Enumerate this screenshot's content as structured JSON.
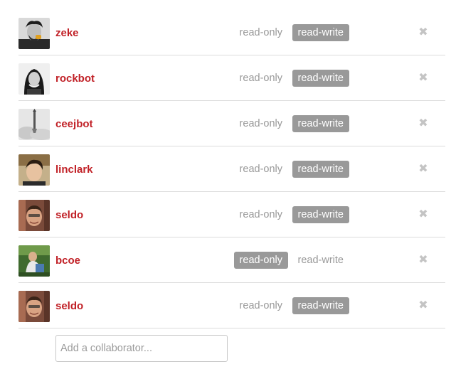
{
  "collaborators": [
    {
      "username": "zeke",
      "avatar_icon": "avatar-zeke-icon",
      "read_only_label": "read-only",
      "read_write_label": "read-write",
      "permission": "read-write",
      "remove_icon": "close-x-icon"
    },
    {
      "username": "rockbot",
      "avatar_icon": "avatar-rockbot-icon",
      "read_only_label": "read-only",
      "read_write_label": "read-write",
      "permission": "read-write",
      "remove_icon": "close-x-icon"
    },
    {
      "username": "ceejbot",
      "avatar_icon": "avatar-ceejbot-icon",
      "read_only_label": "read-only",
      "read_write_label": "read-write",
      "permission": "read-write",
      "remove_icon": "close-x-icon"
    },
    {
      "username": "linclark",
      "avatar_icon": "avatar-linclark-icon",
      "read_only_label": "read-only",
      "read_write_label": "read-write",
      "permission": "read-write",
      "remove_icon": "close-x-icon"
    },
    {
      "username": "seldo",
      "avatar_icon": "avatar-seldo-icon",
      "read_only_label": "read-only",
      "read_write_label": "read-write",
      "permission": "read-write",
      "remove_icon": "close-x-icon"
    },
    {
      "username": "bcoe",
      "avatar_icon": "avatar-bcoe-icon",
      "read_only_label": "read-only",
      "read_write_label": "read-write",
      "permission": "read-only",
      "remove_icon": "close-x-icon"
    },
    {
      "username": "seldo",
      "avatar_icon": "avatar-seldo-icon",
      "read_only_label": "read-only",
      "read_write_label": "read-write",
      "permission": "read-write",
      "remove_icon": "close-x-icon"
    }
  ],
  "add_collaborator": {
    "placeholder": "Add a collaborator...",
    "value": ""
  },
  "colors": {
    "username": "#c12127",
    "active_badge_bg": "#999999",
    "inactive_text": "#999999",
    "divider": "#dcdcdc",
    "remove_icon": "#c4c4c4"
  }
}
